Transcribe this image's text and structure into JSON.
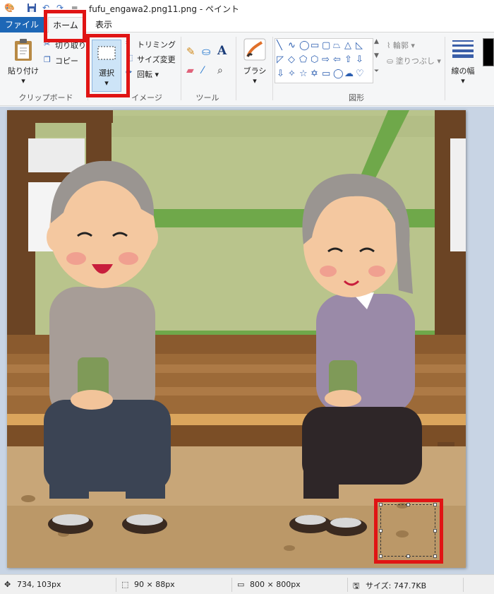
{
  "window": {
    "title": "fufu_engawa2.png11.png - ペイント",
    "quick_access": [
      "save-icon",
      "undo-icon",
      "redo-icon",
      "customize-icon"
    ]
  },
  "tabs": [
    {
      "label": "ファイル",
      "active": false
    },
    {
      "label": "ホーム",
      "active": true
    },
    {
      "label": "表示",
      "active": false
    }
  ],
  "ribbon": {
    "clipboard": {
      "paste_label": "貼り付け",
      "cut_label": "切り取り",
      "copy_label": "コピー",
      "group_label": "クリップボード"
    },
    "image": {
      "select_label": "選択",
      "crop_label": "トリミング",
      "resize_label": "サイズ変更",
      "rotate_label": "回転",
      "group_label": "イメージ"
    },
    "tools": {
      "group_label": "ツール",
      "items": [
        "pencil-icon",
        "fill-icon",
        "text-icon",
        "eraser-icon",
        "color-picker-icon",
        "magnifier-icon"
      ]
    },
    "brush": {
      "label": "ブラシ"
    },
    "shapes": {
      "group_label": "図形",
      "outline_label": "輪郭",
      "fill_label": "塗りつぶし"
    },
    "size": {
      "label": "線の幅"
    }
  },
  "status": {
    "cursor_pos": "734, 103px",
    "selection_size": "90 × 88px",
    "image_size": "800 × 800px",
    "file_size": "サイズ: 747.7KB"
  },
  "colors": {
    "file_tab": "#1d67b6",
    "highlight": "#e01414",
    "select_button": "#cde4f7",
    "canvas_bg": "#c8d4e4"
  }
}
